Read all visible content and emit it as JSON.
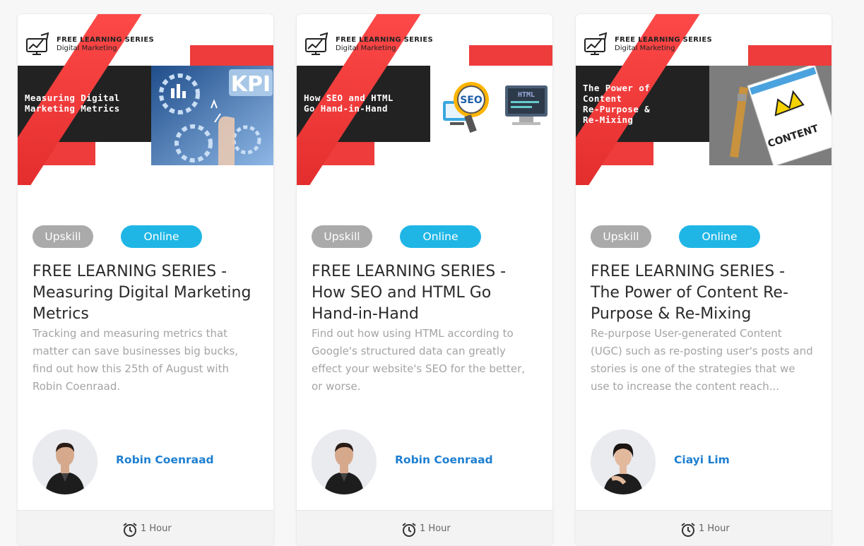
{
  "brand": {
    "red": "#ee3b3b",
    "dark": "#222222",
    "online_blue": "#1fb6e6",
    "upskill_grey": "#aaaaaa",
    "author_blue": "#1e7fd1"
  },
  "cards": [
    {
      "banner_series": "FREE LEARNING SERIES",
      "banner_sub": "Digital Marketing",
      "banner_title": "Measuring Digital\nMarketing Metrics",
      "banner_photo_text": "KPI",
      "tag_1": "Upskill",
      "tag_2": "Online",
      "title": "FREE LEARNING SERIES - Measuring Digital Marketing Metrics",
      "description": "Tracking and measuring metrics that matter can save businesses big bucks, find out how this 25th of August with Robin Coenraad.",
      "author": "Robin Coenraad",
      "duration": "1 Hour",
      "icons": {
        "logo": "chart-monitor-icon",
        "clock": "alarm-clock-icon"
      }
    },
    {
      "banner_series": "FREE LEARNING SERIES",
      "banner_sub": "Digital Marketing",
      "banner_title": "How SEO and HTML\nGo Hand-in-Hand",
      "banner_photo_text": "SEO",
      "banner_photo_text_2": "HTML",
      "tag_1": "Upskill",
      "tag_2": "Online",
      "title": "FREE LEARNING SERIES - How SEO and HTML Go Hand-in-Hand",
      "description": "Find out how using HTML according to Google's structured data can greatly effect your website's SEO for the better, or worse.",
      "author": "Robin Coenraad",
      "duration": "1 Hour",
      "icons": {
        "logo": "chart-monitor-icon",
        "clock": "alarm-clock-icon"
      }
    },
    {
      "banner_series": "FREE LEARNING SERIES",
      "banner_sub": "Digital Marketing",
      "banner_title": "The Power of\nContent\nRe-Purpose &\nRe-Mixing",
      "banner_photo_text": "CONTENT",
      "tag_1": "Upskill",
      "tag_2": "Online",
      "title": "FREE LEARNING SERIES - The Power of Content Re-Purpose & Re-Mixing",
      "description": "Re-purpose User-generated Content (UGC) such as re-posting user's posts and stories is one of the strategies that we use to increase the content reach...",
      "author": "Ciayi Lim",
      "duration": "1 Hour",
      "icons": {
        "logo": "chart-monitor-icon",
        "clock": "alarm-clock-icon"
      }
    }
  ]
}
